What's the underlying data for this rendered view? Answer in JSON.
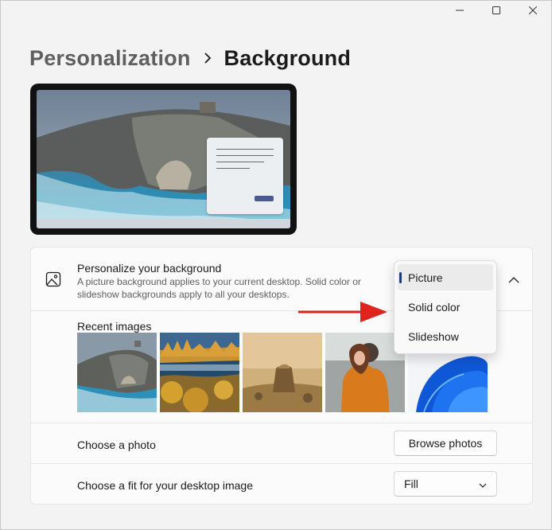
{
  "window": {
    "controls": [
      "minimize-icon",
      "maximize-icon",
      "close-icon"
    ]
  },
  "breadcrumb": {
    "parent": "Personalization",
    "separator_icon": "chevron-right-icon",
    "current": "Background"
  },
  "preview": {
    "description_icon": "desktop-preview"
  },
  "personalize": {
    "icon": "image-icon",
    "title": "Personalize your background",
    "description": "A picture background applies to your current desktop. Solid color or slideshow backgrounds apply to all your desktops.",
    "selected": "Picture",
    "options": [
      "Picture",
      "Solid color",
      "Slideshow"
    ],
    "expand_icon": "chevron-up-icon"
  },
  "recent_images": {
    "label": "Recent images",
    "items": [
      "rocky-coast-thumbnail",
      "autumn-trees-thumbnail",
      "desert-rock-thumbnail",
      "woman-orange-sweater-thumbnail",
      "windows-bloom-thumbnail"
    ]
  },
  "choose_photo": {
    "label": "Choose a photo",
    "button": "Browse photos"
  },
  "fit": {
    "label": "Choose a fit for your desktop image",
    "value": "Fill",
    "icon": "chevron-down-icon"
  },
  "annotation": {
    "arrow_color": "#e0231c"
  },
  "colors": {
    "accent": "#1a3c7a",
    "background": "#f3f3f3",
    "card": "#fbfbfb"
  }
}
